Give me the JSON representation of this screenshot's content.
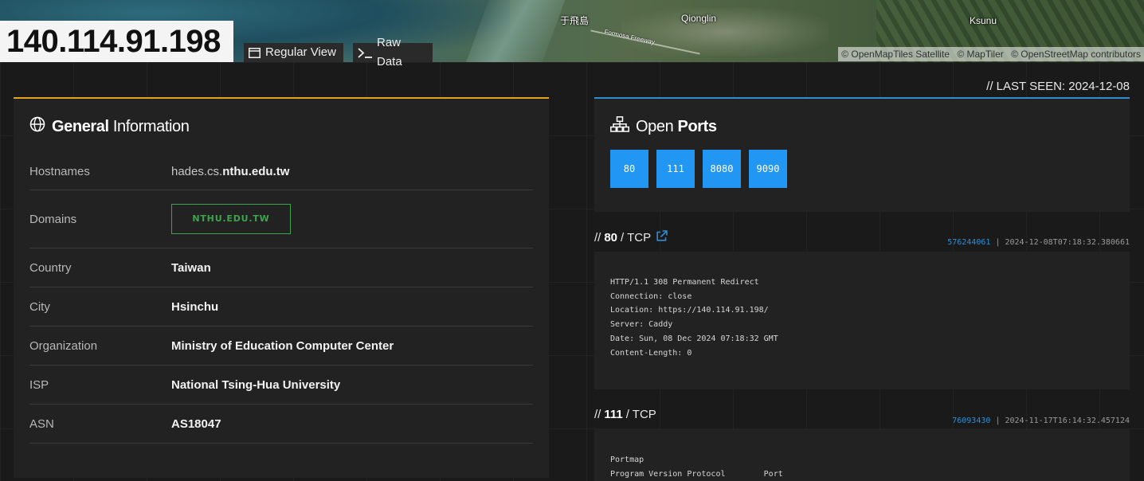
{
  "header": {
    "ip": "140.114.91.198",
    "regular_view_label": "Regular View",
    "raw_data_label": "Raw Data"
  },
  "map": {
    "labels": [
      "于飛島",
      "Qionglin",
      "Ksunu"
    ],
    "road_label": "Formosa Freeway",
    "attribution": [
      "© OpenMapTiles Satellite",
      "© MapTiler",
      "© OpenStreetMap contributors"
    ]
  },
  "last_seen": "// LAST SEEN: 2024-12-08",
  "general": {
    "title_bold": "General",
    "title_light": "Information",
    "rows": [
      {
        "label": "Hostnames",
        "value_prefix": "hades.cs.",
        "value_bold": "nthu.edu.tw"
      },
      {
        "label": "Domains",
        "badge": "NTHU.EDU.TW"
      },
      {
        "label": "Country",
        "value": "Taiwan"
      },
      {
        "label": "City",
        "value": "Hsinchu"
      },
      {
        "label": "Organization",
        "value": "Ministry of Education Computer Center"
      },
      {
        "label": "ISP",
        "value": "National Tsing-Hua University"
      },
      {
        "label": "ASN",
        "value": "AS18047"
      }
    ]
  },
  "open_ports": {
    "title_light": "Open",
    "title_bold": "Ports",
    "ports": [
      "80",
      "111",
      "8080",
      "9090"
    ]
  },
  "services": [
    {
      "prefix": "//",
      "port": "80",
      "proto": "/ TCP",
      "hash": "576244061",
      "timestamp": "| 2024-12-08T07:18:32.380661",
      "banner": "HTTP/1.1 308 Permanent Redirect\nConnection: close\nLocation: https://140.114.91.198/\nServer: Caddy\nDate: Sun, 08 Dec 2024 07:18:32 GMT\nContent-Length: 0"
    },
    {
      "prefix": "//",
      "port": "111",
      "proto": "/ TCP",
      "hash": "76093430",
      "timestamp": "| 2024-11-17T16:14:32.457124",
      "banner": "Portmap\nProgram Version Protocol        Port"
    }
  ],
  "colors": {
    "general_accent": "#e5a21d",
    "ports_accent": "#2c8fd6",
    "port_box": "#2196f3",
    "domain_badge": "#3fa34d"
  }
}
